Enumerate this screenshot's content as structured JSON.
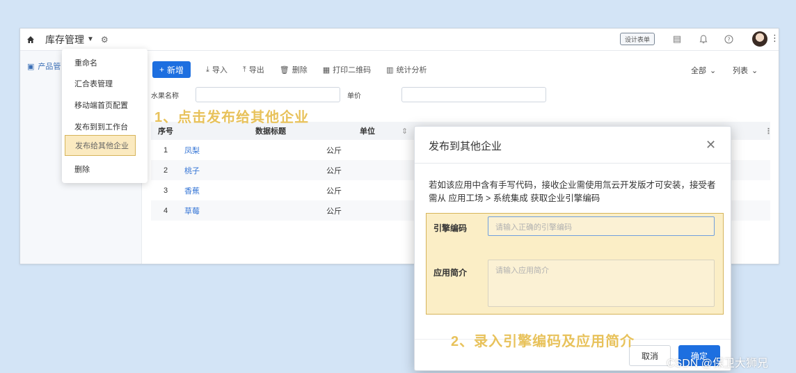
{
  "header": {
    "app_title": "库存管理",
    "design_button": "设计表单"
  },
  "sidebar": {
    "item": "产品管"
  },
  "toolbar": {
    "new": "新增",
    "import": "导入",
    "export": "导出",
    "delete": "删除",
    "qrcode": "打印二维码",
    "stats": "统计分析",
    "all": "全部",
    "view": "列表"
  },
  "filters": {
    "name_label": "水果名称",
    "price_label": "单价"
  },
  "table": {
    "headers": {
      "no": "序号",
      "title": "数据标题",
      "unit": "单位"
    },
    "rows": [
      {
        "no": "1",
        "title": "凤梨",
        "unit": "公斤"
      },
      {
        "no": "2",
        "title": "桃子",
        "unit": "公斤"
      },
      {
        "no": "3",
        "title": "香蕉",
        "unit": "公斤"
      },
      {
        "no": "4",
        "title": "草莓",
        "unit": "公斤"
      }
    ]
  },
  "context_menu": {
    "items": [
      "重命名",
      "汇合表管理",
      "移动端首页配置",
      "发布到到工作台",
      "发布给其他企业",
      "删除"
    ]
  },
  "annotations": {
    "step1": "1、点击发布给其他企业",
    "step2": "2、录入引擎编码及应用简介"
  },
  "modal": {
    "title": "发布到其他企业",
    "description": "若如该应用中含有手写代码，接收企业需使用氚云开发版才可安装，接受者需从 应用工场 > 系统集成 获取企业引擎编码",
    "engine_label": "引擎编码",
    "engine_placeholder": "请输入正确的引擎编码",
    "intro_label": "应用简介",
    "intro_placeholder": "请输入应用简介",
    "cancel": "取消",
    "ok": "确定"
  },
  "watermark": "CSDN @保卫大狮兄"
}
